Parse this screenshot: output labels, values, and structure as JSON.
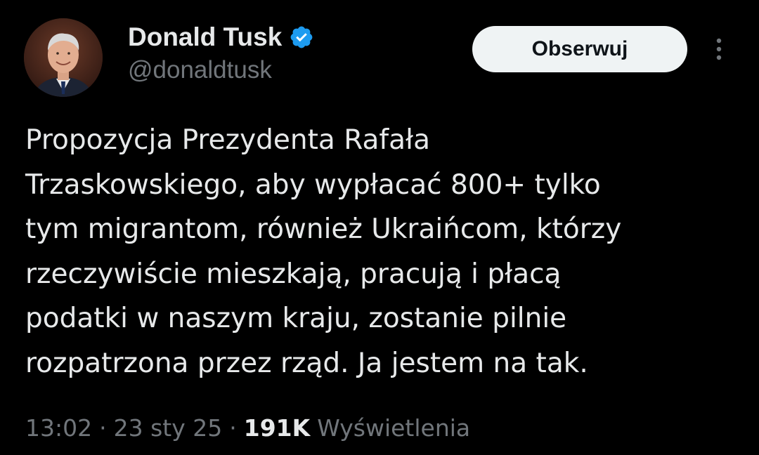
{
  "author": {
    "display_name": "Donald Tusk",
    "handle": "@donaldtusk",
    "verified_icon": "verified-badge-icon",
    "avatar_icon": "profile-photo"
  },
  "actions": {
    "follow_label": "Obserwuj",
    "more_icon": "more-vertical-icon"
  },
  "tweet": {
    "text": "Propozycja Prezydenta Rafała\nTrzaskowskiego, aby wypłacać 800+ tylko\ntym migrantom, również Ukraińcom, którzy\nrzeczywiście mieszkają, pracują i płacą\npodatki w naszym kraju, zostanie pilnie\nrozpatrzona przez rząd. Ja jestem na tak."
  },
  "meta": {
    "time": "13:02",
    "separator": "·",
    "date": "23 sty 25",
    "views_count": "191K",
    "views_label": "Wyświetlenia"
  },
  "colors": {
    "background": "#000000",
    "text_primary": "#e7e9ea",
    "text_secondary": "#71767b",
    "verified_blue": "#1d9bf0",
    "follow_button_bg": "#eff3f4"
  }
}
